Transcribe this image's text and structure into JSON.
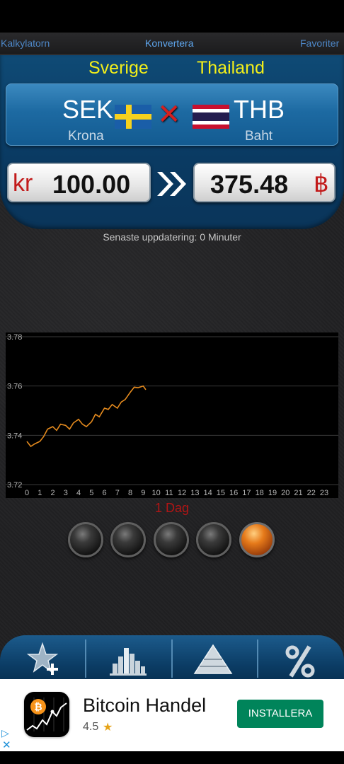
{
  "tabs": [
    "Kalkylatorn",
    "Konvertera",
    "Favoriter"
  ],
  "from": {
    "country": "Sverige",
    "code": "SEK",
    "name": "Krona",
    "symbol": "kr",
    "amount": "100.00",
    "flag": "sweden-flag"
  },
  "to": {
    "country": "Thailand",
    "code": "THB",
    "name": "Baht",
    "symbol": "฿",
    "amount": "375.48",
    "flag": "thailand-flag"
  },
  "swap_icon": "swap-x-icon",
  "convert_icon": "double-chevron-icon",
  "update_text": "Senaste uppdatering: 0 Minuter",
  "chart_data": {
    "type": "line",
    "title": "",
    "xlabel": "",
    "ylabel": "",
    "ylim": [
      3.72,
      3.78
    ],
    "yticks": [
      "3.72",
      "3.74",
      "3.76",
      "3.78"
    ],
    "xticks": [
      "0",
      "1",
      "2",
      "3",
      "4",
      "5",
      "6",
      "7",
      "8",
      "9",
      "10",
      "11",
      "12",
      "13",
      "14",
      "15",
      "16",
      "17",
      "18",
      "19",
      "20",
      "21",
      "22",
      "23"
    ],
    "xlim": [
      0,
      23
    ],
    "grid": true,
    "line_color": "#e48a1e",
    "series": [
      {
        "x": [
          0,
          0.3,
          0.6,
          1,
          1.3,
          1.6,
          2,
          2.3,
          2.6,
          3,
          3.3,
          3.6,
          4,
          4.3,
          4.6,
          5,
          5.3,
          5.6,
          6,
          6.3,
          6.6,
          7,
          7.3,
          7.6,
          8,
          8.3,
          8.6,
          9,
          9.2
        ],
        "y": [
          3.7375,
          3.7355,
          3.7365,
          3.7375,
          3.7395,
          3.7425,
          3.7435,
          3.742,
          3.7445,
          3.744,
          3.7425,
          3.745,
          3.7465,
          3.7445,
          3.7435,
          3.7455,
          3.7485,
          3.7475,
          3.751,
          3.7505,
          3.7525,
          3.751,
          3.7535,
          3.7545,
          3.7575,
          3.7595,
          3.7593,
          3.76,
          3.7585
        ]
      }
    ]
  },
  "period_label": "1 Dag",
  "range_buttons": [
    "range-1",
    "range-2",
    "range-3",
    "range-4",
    "range-5"
  ],
  "bottom_nav": [
    "add-favorite-icon",
    "chart-icon",
    "pyramid-icon",
    "percent-icon"
  ],
  "ad": {
    "title": "Bitcoin Handel",
    "rating": "4.5",
    "button": "INSTALLERA",
    "icon": "bitcoin-app-icon"
  }
}
